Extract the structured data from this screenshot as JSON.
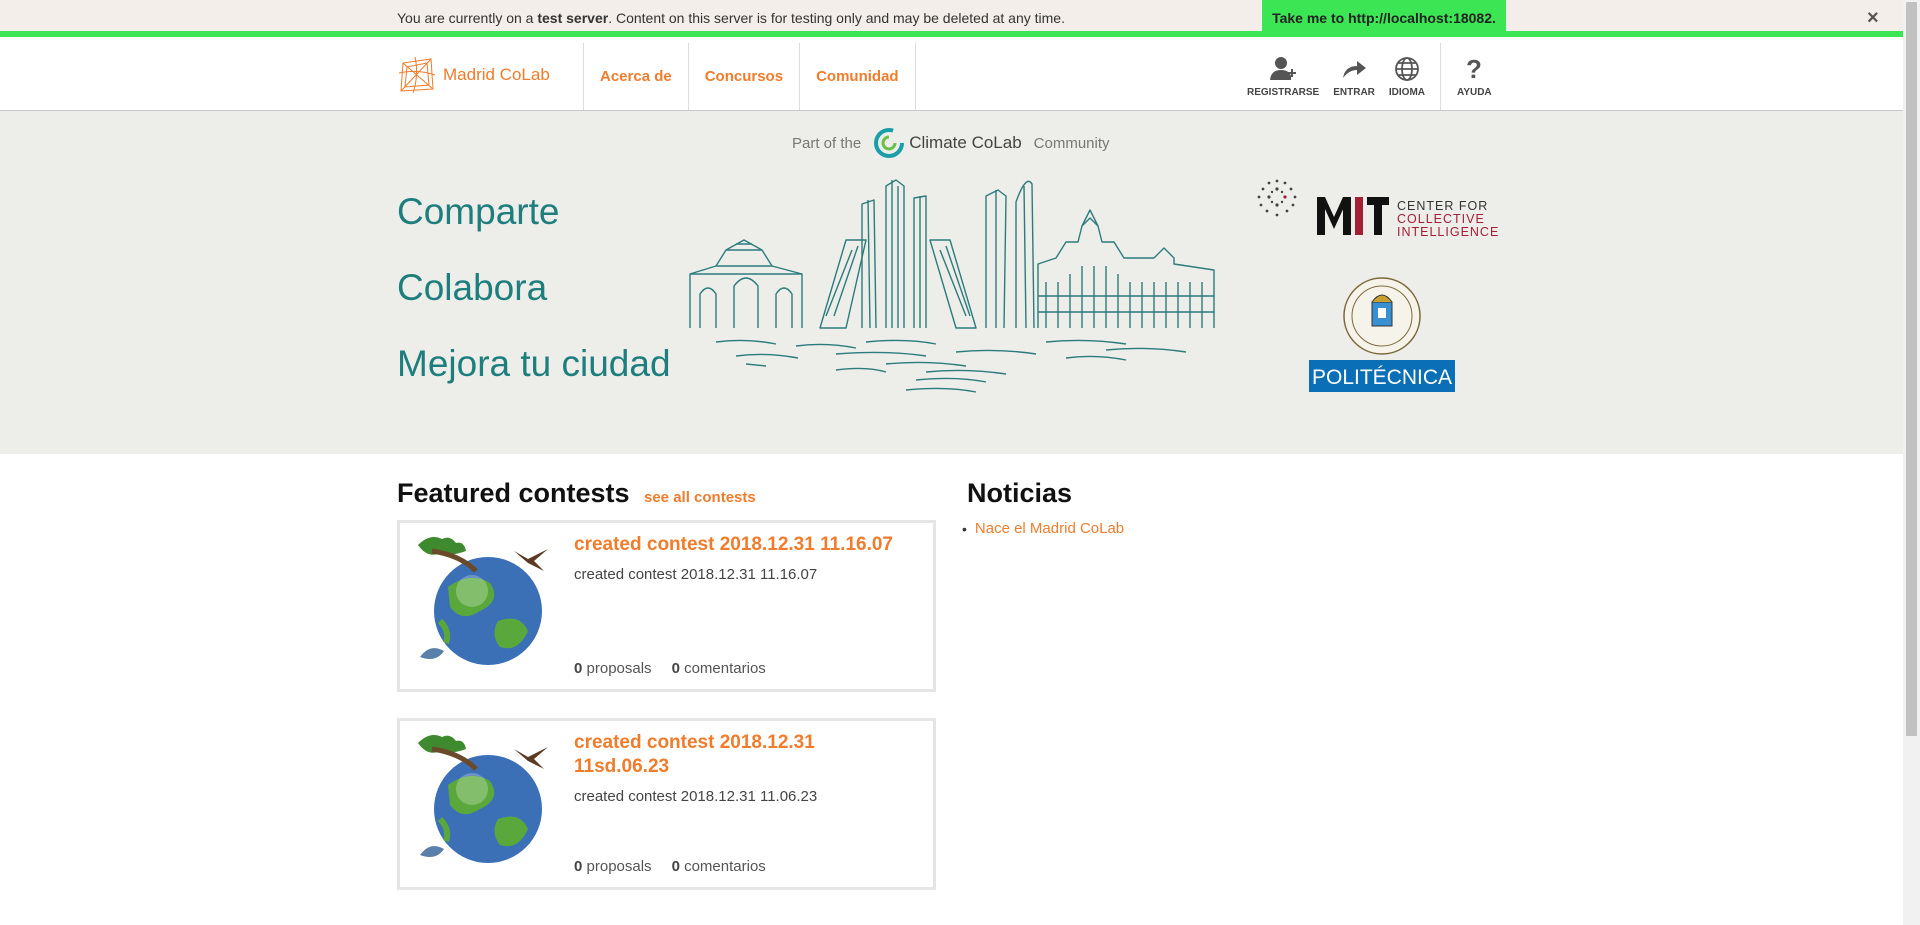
{
  "banner": {
    "msg_prefix": "You are currently on a ",
    "msg_bold": "test server",
    "msg_suffix": ". Content on this server is for testing only and may be deleted at any time.",
    "take_me": "Take me to http://localhost:18082.",
    "close": "×"
  },
  "header": {
    "logo": "Madrid CoLab",
    "nav": [
      "Acerca de",
      "Concursos",
      "Comunidad"
    ],
    "tools": {
      "register": "REGISTRARSE",
      "login": "ENTRAR",
      "language": "IDIOMA",
      "help": "AYUDA"
    }
  },
  "hero": {
    "part_of": "Part of the",
    "brand": "Climate CoLab",
    "community": "Community",
    "words": [
      "Comparte",
      "Colabora",
      "Mejora tu ciudad"
    ],
    "mit_center": "CENTER FOR",
    "mit_collective": "COLLECTIVE",
    "mit_intelligence": "INTELLIGENCE",
    "upm_label": "POLITÉCNICA"
  },
  "featured": {
    "title": "Featured contests",
    "see_all": "see all contests",
    "cards": [
      {
        "title": "created contest 2018.12.31 11.16.07",
        "desc": "created contest 2018.12.31 11.16.07",
        "proposals": "0",
        "proposals_label": "proposals",
        "comments": "0",
        "comments_label": "comentarios"
      },
      {
        "title": "created contest 2018.12.31 11sd.06.23",
        "desc": "created contest 2018.12.31 11.06.23",
        "proposals": "0",
        "proposals_label": "proposals",
        "comments": "0",
        "comments_label": "comentarios"
      }
    ]
  },
  "news": {
    "title": "Noticias",
    "items": [
      "Nace el Madrid CoLab"
    ]
  },
  "colors": {
    "accent": "#f07c2c",
    "teal": "#1e7e7e",
    "banner_green": "#3ce554"
  }
}
